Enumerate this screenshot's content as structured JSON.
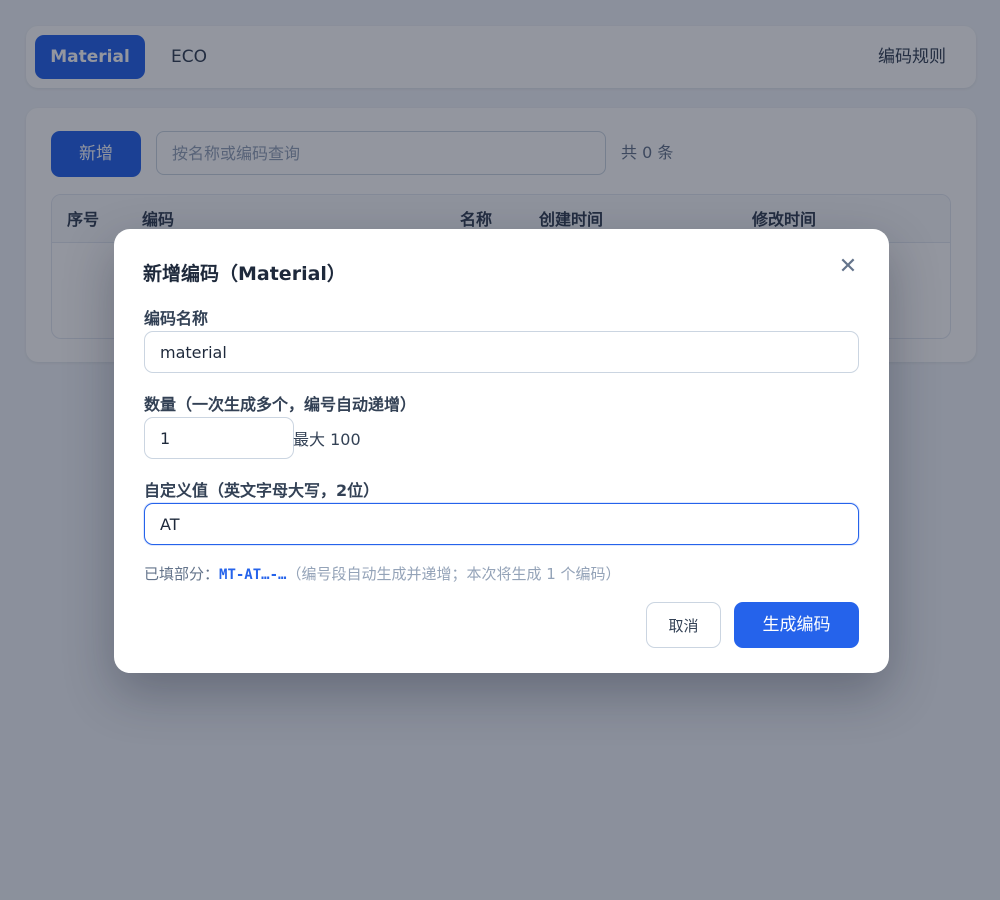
{
  "nav": {
    "tabs": [
      {
        "label": "Material",
        "active": true
      },
      {
        "label": "ECO",
        "active": false
      }
    ],
    "rules_link": "编码规则"
  },
  "list": {
    "add_button": "新增",
    "search_placeholder": "按名称或编码查询",
    "count_text": "共 0 条",
    "columns": [
      "序号",
      "编码",
      "名称",
      "创建时间",
      "修改时间"
    ]
  },
  "modal": {
    "title": "新增编码（Material）",
    "close_icon": "close-icon",
    "name_label": "编码名称",
    "name_value": "material",
    "quantity_label": "数量（一次生成多个，编号自动递增）",
    "quantity_value": "1",
    "quantity_max": "最大 100",
    "custom_label": "自定义值（英文字母大写，2位）",
    "custom_value": "AT",
    "filled_prefix": "已填部分：",
    "filled_code": "MT-AT…-…",
    "filled_note": "（编号段自动生成并递增；本次将生成 1 个编码）",
    "cancel_button": "取消",
    "generate_button": "生成编码"
  },
  "colors": {
    "accent": "#2563eb",
    "overlay": "rgba(15,23,42,0.45)"
  }
}
